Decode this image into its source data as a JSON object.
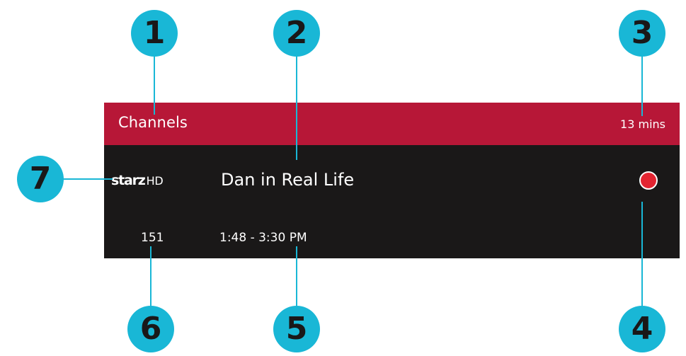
{
  "header": {
    "title": "Channels",
    "time_remaining": "13 mins"
  },
  "program": {
    "network_logo_text": "starz",
    "network_logo_suffix": "HD",
    "title": "Dan in Real Life",
    "channel_number": "151",
    "time_range": "1:48 - 3:30 PM",
    "recording_indicator": "record-dot-icon"
  },
  "callouts": [
    "1",
    "2",
    "3",
    "4",
    "5",
    "6",
    "7"
  ],
  "colors": {
    "header_bg": "#b71737",
    "body_bg": "#1a1818",
    "callout": "#19b7d6",
    "record": "#e32431",
    "text": "#ffffff"
  }
}
